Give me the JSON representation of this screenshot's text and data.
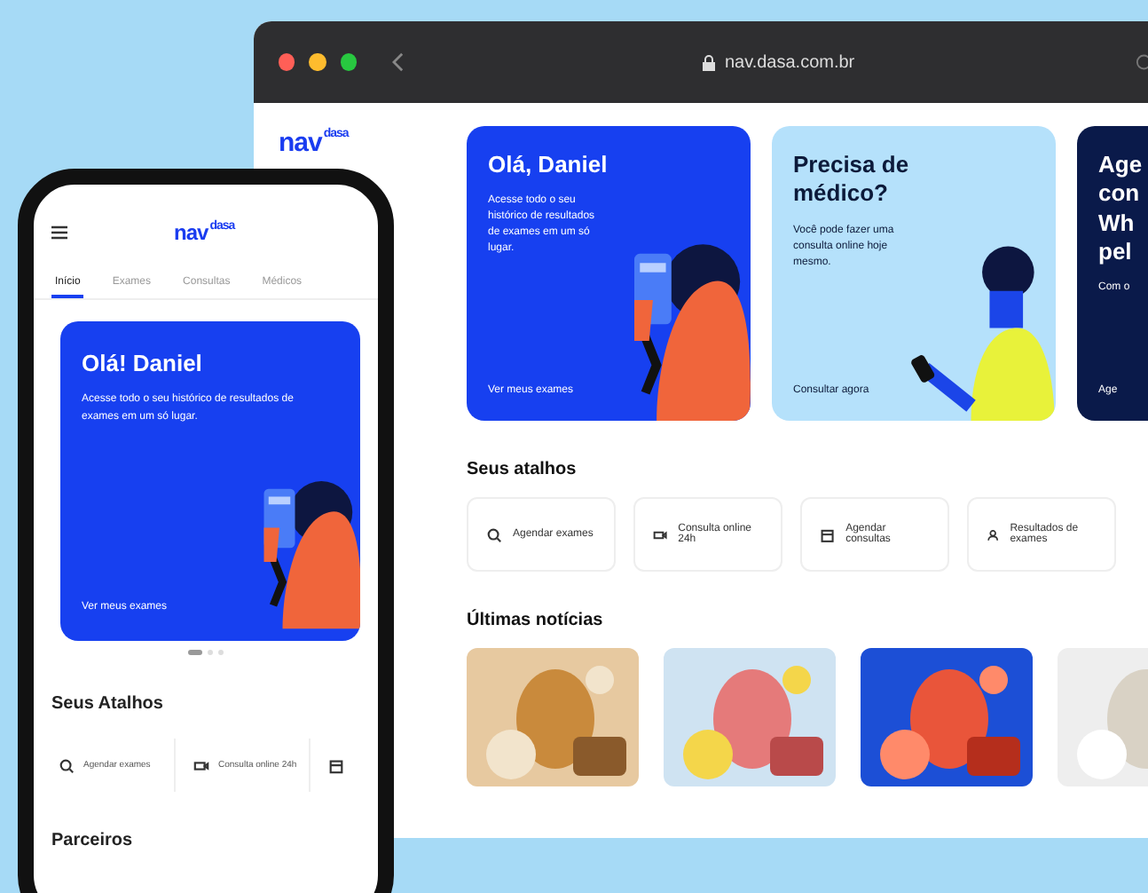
{
  "browser": {
    "url": "nav.dasa.com.br",
    "logo": {
      "text": "nav",
      "sup": "dasa"
    },
    "cards": [
      {
        "kind": "blue",
        "title": [
          "Olá, Daniel"
        ],
        "body": "Acesse todo o seu histórico de resultados de exames em um só lugar.",
        "link": "Ver meus exames"
      },
      {
        "kind": "light",
        "title": [
          "Precisa de",
          "médico?"
        ],
        "body": "Você pode fazer uma consulta online hoje mesmo.",
        "link": "Consultar agora"
      },
      {
        "kind": "dark",
        "title": [
          "Age",
          "con",
          "Wh",
          "pel"
        ],
        "body": "Com o",
        "link": "Age"
      }
    ],
    "shortcuts_title": "Seus atalhos",
    "shortcuts": [
      {
        "kind": "search",
        "label": "Agendar exames"
      },
      {
        "kind": "video",
        "label": "Consulta online 24h"
      },
      {
        "kind": "calendar",
        "label": "Agendar consultas"
      },
      {
        "kind": "user",
        "label": "Resultados de exames"
      }
    ],
    "news_title": "Últimas notícias"
  },
  "phone": {
    "logo": {
      "text": "nav",
      "sup": "dasa"
    },
    "tabs": [
      {
        "label": "Início",
        "selected": true
      },
      {
        "label": "Exames",
        "selected": false
      },
      {
        "label": "Consultas",
        "selected": false
      },
      {
        "label": "Médicos",
        "selected": false
      }
    ],
    "card": {
      "title": "Olá! Daniel",
      "body": "Acesse todo o seu histórico de resultados de exames em um só lugar.",
      "link": "Ver meus exames"
    },
    "shortcuts_title": "Seus Atalhos",
    "shortcuts": [
      {
        "kind": "search",
        "label": "Agendar exames"
      },
      {
        "kind": "video",
        "label": "Consulta online 24h"
      },
      {
        "kind": "calendar"
      }
    ],
    "partners_title": "Parceiros"
  }
}
